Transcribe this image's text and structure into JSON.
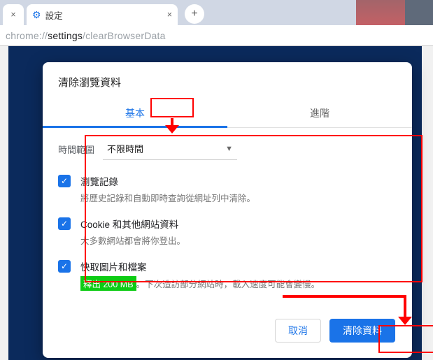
{
  "browser": {
    "tab_close_inactive": "×",
    "tab_title": "設定",
    "tab_close": "×",
    "new_tab": "+",
    "url_prefix": "chrome://",
    "url_mid": "settings",
    "url_suffix": "/clearBrowserData"
  },
  "dialog": {
    "title": "清除瀏覽資料",
    "tab_basic": "基本",
    "tab_advanced": "進階",
    "range_label": "時間範圍",
    "range_value": "不限時間",
    "opts": [
      {
        "title": "瀏覽記錄",
        "desc": "將歷史記錄和自動即時查詢從網址列中清除。"
      },
      {
        "title": "Cookie 和其他網站資料",
        "desc": "大多數網站都會將你登出。"
      },
      {
        "title": "快取圖片和檔案",
        "release": "釋出 200 MB",
        "desc_after": "。下次造訪部分網站時，載入速度可能會變慢。"
      }
    ],
    "cancel": "取消",
    "clear": "清除資料"
  }
}
